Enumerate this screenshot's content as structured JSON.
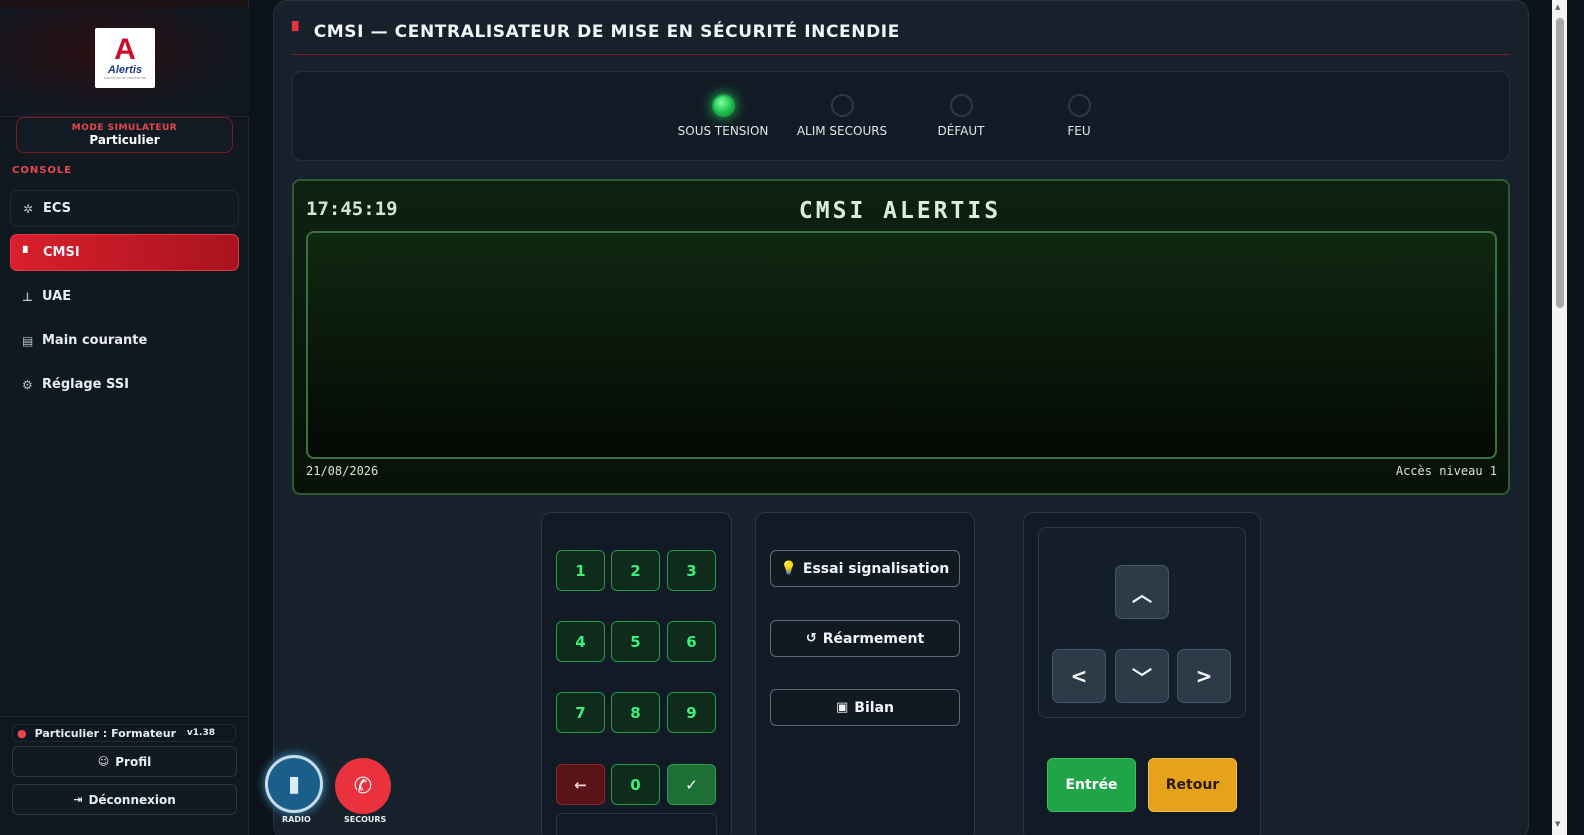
{
  "sidebar": {
    "logo_letter": "A",
    "logo_text": "Alertis",
    "logo_sub": "SOLUTIONS DE PRÉVENTION",
    "mode_label": "MODE SIMULATEUR",
    "mode_value": "Particulier",
    "section_label": "CONSOLE",
    "items": [
      {
        "label": "ECS",
        "icon": "chip-icon"
      },
      {
        "label": "CMSI",
        "icon": "fire-extinguisher-icon"
      },
      {
        "label": "UAE",
        "icon": "sitemap-icon"
      },
      {
        "label": "Main courante",
        "icon": "book-icon"
      },
      {
        "label": "Réglage SSI",
        "icon": "gear-icon"
      }
    ],
    "user": "Particulier : Formateur",
    "version": "v1.38",
    "profil_label": "Profil",
    "logout_label": "Déconnexion"
  },
  "floating": {
    "radio_label": "RADIO",
    "secours_label": "SECOURS"
  },
  "main": {
    "title": "CMSI — CENTRALISATEUR DE MISE EN SÉCURITÉ INCENDIE",
    "leds": [
      {
        "label": "SOUS TENSION",
        "on": true
      },
      {
        "label": "ALIM SECOURS",
        "on": false
      },
      {
        "label": "DÉFAUT",
        "on": false
      },
      {
        "label": "FEU",
        "on": false
      }
    ],
    "lcd": {
      "time": "17:45:19",
      "title": "CMSI ALERTIS",
      "date": "21/08/2026",
      "access": "Accès niveau 1"
    },
    "keypad": [
      "1",
      "2",
      "3",
      "4",
      "5",
      "6",
      "7",
      "8",
      "9",
      "←",
      "0",
      "✓"
    ],
    "actions": {
      "essai": "Essai signalisation",
      "rearm": "Réarmement",
      "bilan": "Bilan"
    },
    "nav": {
      "entree": "Entrée",
      "retour": "Retour"
    }
  },
  "colors": {
    "accent_red": "#d91f2c",
    "led_green": "#22d35a",
    "entree_green": "#20a448",
    "retour_orange": "#e7a21c"
  }
}
